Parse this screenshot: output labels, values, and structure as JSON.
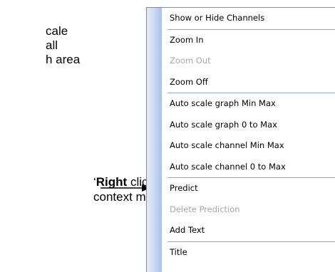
{
  "document": {
    "lines": [
      "cale",
      "all",
      "h area"
    ],
    "callout": {
      "prefix": "‘",
      "bold": "Right",
      "suffix": " click’",
      "line2": "context menu"
    }
  },
  "context_menu": {
    "groups": [
      [
        {
          "label": "Show or Hide Channels",
          "enabled": true
        }
      ],
      [
        {
          "label": "Zoom In",
          "enabled": true
        },
        {
          "label": "Zoom Out",
          "enabled": false
        },
        {
          "label": "Zoom Off",
          "enabled": true
        }
      ],
      [
        {
          "label": "Auto scale graph Min  Max",
          "enabled": true
        },
        {
          "label": "Auto scale graph 0 to Max",
          "enabled": true
        },
        {
          "label": "Auto scale channel Min  Max",
          "enabled": true
        },
        {
          "label": "Auto scale channel 0 to Max",
          "enabled": true
        }
      ],
      [
        {
          "label": "Predict",
          "enabled": true
        },
        {
          "label": "Delete Prediction",
          "enabled": false
        },
        {
          "label": "Add Text",
          "enabled": true
        }
      ],
      [
        {
          "label": "Title",
          "enabled": true
        }
      ]
    ],
    "colors": {
      "disabled_text": "#a7a6a6",
      "separator": "#8aa6d6",
      "strip_light": "#e3ebfa",
      "strip_dark": "#a9c0e8"
    }
  }
}
